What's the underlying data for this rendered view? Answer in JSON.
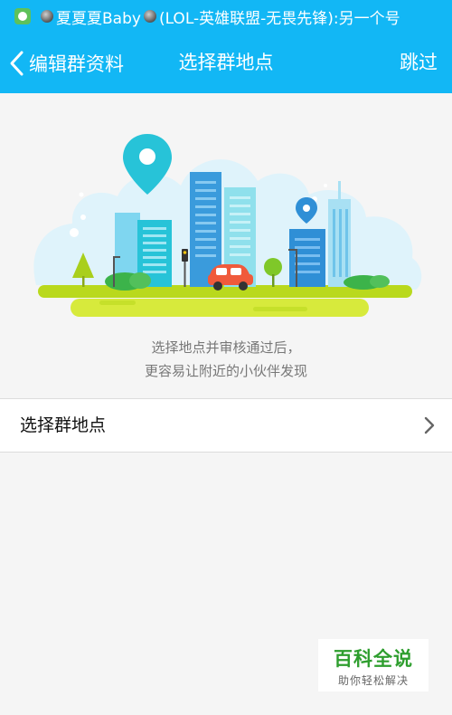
{
  "status_bar": {
    "app_icon": "qq-chat-icon",
    "name_part1": "夏夏夏Baby",
    "name_part2": "(LOL-英雄联盟-无畏先锋):另一个号"
  },
  "nav": {
    "back_label": "编辑群资料",
    "title": "选择群地点",
    "skip_label": "跳过",
    "background": "#12b7f5"
  },
  "illustration": {
    "icon": "city-map-illustration"
  },
  "description": {
    "line1": "选择地点并审核通过后，",
    "line2": "更容易让附近的小伙伴发现"
  },
  "list": {
    "item_label": "选择群地点"
  },
  "watermark": {
    "title": "百科全说",
    "subtitle": "助你轻松解决"
  }
}
